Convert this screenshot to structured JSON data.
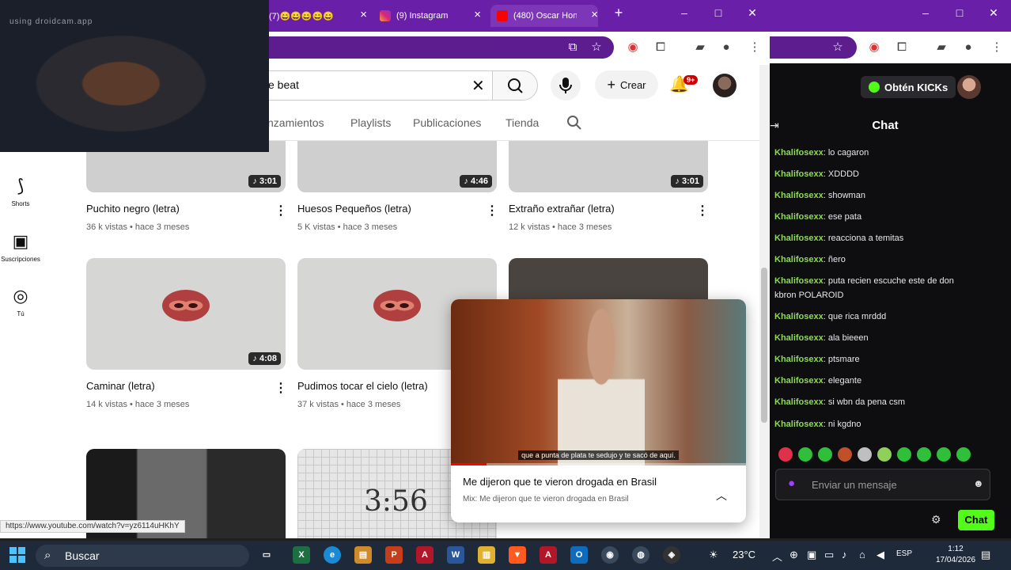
{
  "browser": {
    "tabs": [
      {
        "label": "(7)😄😄😄😄😄"
      },
      {
        "label": "(9) Instagram"
      },
      {
        "label": "(480) Oscar Hon"
      }
    ],
    "new_tab_icon": "plus-icon"
  },
  "youtube": {
    "search_value": "e beat",
    "create_label": "Crear",
    "notif_badge": "9+",
    "channel_tabs": [
      "nzamientos",
      "Playlists",
      "Publicaciones",
      "Tienda"
    ],
    "sidebar": [
      {
        "label": "Shorts",
        "icon": "shorts-icon"
      },
      {
        "label": "Suscripciones",
        "icon": "subscriptions-icon"
      },
      {
        "label": "Tú",
        "icon": "you-icon"
      }
    ],
    "videos": [
      {
        "title": "Puchito negro (letra)",
        "meta": "36 k vistas • hace 3 meses",
        "duration": "3:01"
      },
      {
        "title": "Huesos Pequeños (letra)",
        "meta": "5 K vistas • hace 3 meses",
        "duration": "4:46"
      },
      {
        "title": "Extraño extrañar (letra)",
        "meta": "12 k vistas • hace 3 meses",
        "duration": "3:01"
      },
      {
        "title": "Caminar (letra)",
        "meta": "14 k vistas • hace 3 meses",
        "duration": "4:08"
      },
      {
        "title": "Pudimos tocar el cielo (letra)",
        "meta": "37 k vistas • hace 3 meses",
        "duration": ""
      }
    ],
    "row3_thumb_text": "3:56",
    "miniplayer": {
      "subtitle": "que a punta de plata te sedujo y te sacó de aquí.",
      "title": "Me dijeron que te vieron drogada en Brasil",
      "subtitle2": "Mix: Me dijeron que te vieron drogada en Brasil",
      "progress": 0.12
    },
    "status_url": "https://www.youtube.com/watch?v=yz6114uHKhY"
  },
  "webcam": {
    "label": "using droidcam.app"
  },
  "chat": {
    "kicks_label": "Obtén KICKs",
    "title": "Chat",
    "messages": [
      {
        "user": "Khalifosexx",
        "text": ": lo cagaron"
      },
      {
        "user": "Khalifosexx",
        "text": ": XDDDD"
      },
      {
        "user": "Khalifosexx",
        "text": ": showman"
      },
      {
        "user": "Khalifosexx",
        "text": ": ese pata"
      },
      {
        "user": "Khalifosexx",
        "text": ": reacciona a temitas"
      },
      {
        "user": "Khalifosexx",
        "text": ": ñero"
      },
      {
        "user": "Khalifosexx",
        "text": ": puta recien escuche este de don kbron POLAROID"
      },
      {
        "user": "Khalifosexx",
        "text": ": que rica mrddd"
      },
      {
        "user": "Khalifosexx",
        "text": ": ala bieeen"
      },
      {
        "user": "Khalifosexx",
        "text": ": ptsmare"
      },
      {
        "user": "Khalifosexx",
        "text": ": elegante"
      },
      {
        "user": "Khalifosexx",
        "text": ": si wbn da pena csm"
      },
      {
        "user": "Khalifosexx",
        "text": ": ni kgdno"
      }
    ],
    "input_placeholder": "Enviar un mensaje",
    "send_label": "Chat",
    "accent": "#53fc18"
  },
  "taskbar": {
    "search_label": "Buscar",
    "temperature": "23°C",
    "lang": "ESP",
    "time": "1:12",
    "date": "17/04/2026"
  }
}
